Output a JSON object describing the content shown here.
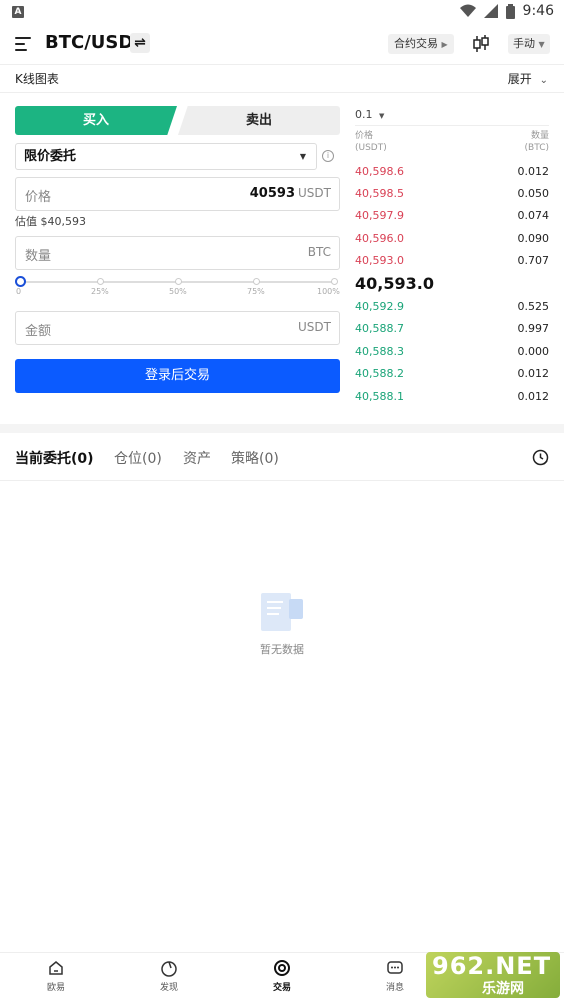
{
  "status_bar": {
    "time": "9:46"
  },
  "header": {
    "pair": "BTC/USDT",
    "contract_label": "合约交易",
    "manual_label": "手动"
  },
  "kline": {
    "label": "K线图表",
    "expand_label": "展开"
  },
  "trade_form": {
    "buy_label": "买入",
    "sell_label": "卖出",
    "order_type": "限价委托",
    "price_label": "价格",
    "price_value": "40593",
    "price_unit": "USDT",
    "estimate": "估值 $40,593",
    "amount_label": "数量",
    "amount_unit": "BTC",
    "slider_ticks": [
      "0",
      "25%",
      "50%",
      "75%",
      "100%"
    ],
    "slider_value": 0,
    "total_label": "金额",
    "total_unit": "USDT",
    "login_button": "登录后交易"
  },
  "order_book": {
    "step": "0.1",
    "price_header": "价格",
    "price_unit": "(USDT)",
    "qty_header": "数量",
    "qty_unit": "(BTC)",
    "asks": [
      {
        "price": "40,598.6",
        "qty": "0.012"
      },
      {
        "price": "40,598.5",
        "qty": "0.050"
      },
      {
        "price": "40,597.9",
        "qty": "0.074"
      },
      {
        "price": "40,596.0",
        "qty": "0.090"
      },
      {
        "price": "40,593.0",
        "qty": "0.707"
      }
    ],
    "mid_price": "40,593.0",
    "bids": [
      {
        "price": "40,592.9",
        "qty": "0.525"
      },
      {
        "price": "40,588.7",
        "qty": "0.997"
      },
      {
        "price": "40,588.3",
        "qty": "0.000"
      },
      {
        "price": "40,588.2",
        "qty": "0.012"
      },
      {
        "price": "40,588.1",
        "qty": "0.012"
      }
    ],
    "ask_color": "#d94155",
    "bid_color": "#1aa478"
  },
  "orders_tabs": {
    "tabs": [
      "当前委托(0)",
      "仓位(0)",
      "资产",
      "策略(0)"
    ],
    "empty_text": "暂无数据"
  },
  "bottom_nav": {
    "items": [
      {
        "label": "欧易",
        "icon": "home-icon"
      },
      {
        "label": "发现",
        "icon": "discover-icon"
      },
      {
        "label": "交易",
        "icon": "trade-icon"
      },
      {
        "label": "消息",
        "icon": "message-icon"
      }
    ]
  },
  "watermark": {
    "big": "962.NET",
    "small": "乐游网"
  },
  "colors": {
    "accent_green": "#1cb482",
    "primary_blue": "#0b5bff"
  }
}
